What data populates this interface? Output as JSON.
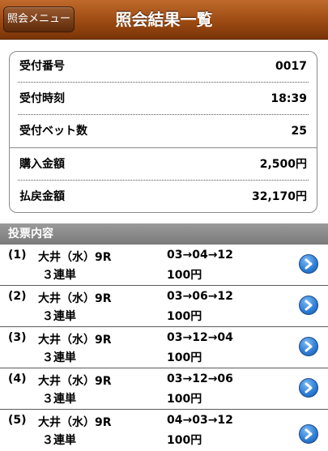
{
  "header": {
    "back_label": "照会メニュー",
    "title": "照会結果一覧"
  },
  "summary": [
    {
      "label": "受付番号",
      "value": "0017"
    },
    {
      "label": "受付時刻",
      "value": "18:39"
    },
    {
      "label": "受付ベット数",
      "value": "25"
    },
    {
      "label": "購入金額",
      "value": "2,500円"
    },
    {
      "label": "払戻金額",
      "value": "32,170円"
    }
  ],
  "section": {
    "title": "投票内容"
  },
  "bets": [
    {
      "num": "(1)",
      "race": "大井（水）9R",
      "type": "３連単",
      "combo": "03→04→12",
      "amount": "100円"
    },
    {
      "num": "(2)",
      "race": "大井（水）9R",
      "type": "３連単",
      "combo": "03→06→12",
      "amount": "100円"
    },
    {
      "num": "(3)",
      "race": "大井（水）9R",
      "type": "３連単",
      "combo": "03→12→04",
      "amount": "100円"
    },
    {
      "num": "(4)",
      "race": "大井（水）9R",
      "type": "３連単",
      "combo": "03→12→06",
      "amount": "100円"
    },
    {
      "num": "(5)",
      "race": "大井（水）9R",
      "type": "３連単",
      "combo": "04→03→12",
      "amount": "100円"
    }
  ],
  "colors": {
    "header": "#9c4a12",
    "section": "#8a8a8a",
    "accent_button": "#2f7fd8"
  },
  "icons": {
    "detail": "chevron-right-icon"
  }
}
